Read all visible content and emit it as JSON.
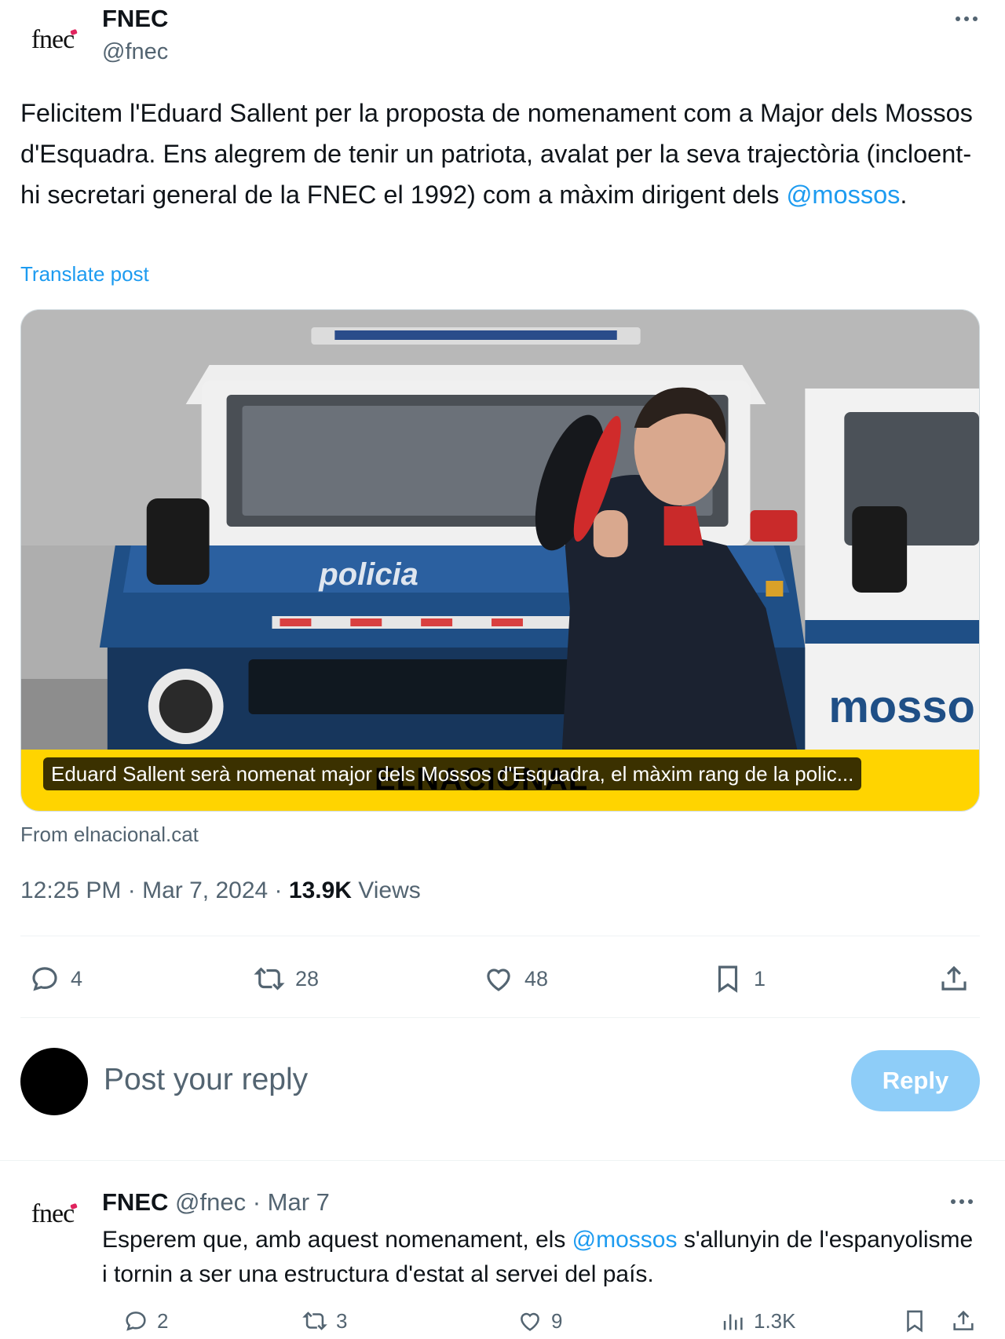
{
  "author": {
    "avatar_text": "fnec",
    "display_name": "FNEC",
    "handle": "@fnec"
  },
  "post": {
    "text_before_mention": "Felicitem l'Eduard Sallent per la proposta de nomenament com a Major dels Mossos d'Esquadra. Ens alegrem de tenir un patriota, avalat per la seva trajectòria (incloent-hi secretari general de la FNEC el 1992) com a màxim dirigent dels ",
    "mention": "@mossos",
    "text_after_mention": ".",
    "translate_label": "Translate post",
    "card": {
      "caption": "Eduard Sallent serà nomenat major dels Mossos d'Esquadra, el màxim rang de la polic...",
      "watermark": "ELNACIONAL",
      "vehicle_text": "policia",
      "side_text": "mosso",
      "source": "From elnacional.cat"
    },
    "time": "12:25 PM",
    "date": "Mar 7, 2024",
    "separator": "·",
    "views_count": "13.9K",
    "views_label": "Views"
  },
  "actions": {
    "replies": "4",
    "reposts": "28",
    "likes": "48",
    "bookmarks": "1"
  },
  "reply_composer": {
    "placeholder": "Post your reply",
    "button_label": "Reply"
  },
  "reply": {
    "avatar_text": "fnec",
    "display_name": "FNEC",
    "handle": "@fnec",
    "separator": "·",
    "date": "Mar 7",
    "text_before_mention": "Esperem que, amb aquest nomenament, els ",
    "mention": "@mossos",
    "text_after_mention": " s'allunyin de l'espanyolisme i tornin a ser una estructura d'estat al servei del país.",
    "actions": {
      "replies": "2",
      "reposts": "3",
      "likes": "9",
      "views": "1.3K"
    }
  },
  "colors": {
    "accent": "#1d9bf0",
    "secondary_text": "#536471",
    "reply_button_disabled": "#8ecdf8",
    "card_band": "#ffd400"
  }
}
